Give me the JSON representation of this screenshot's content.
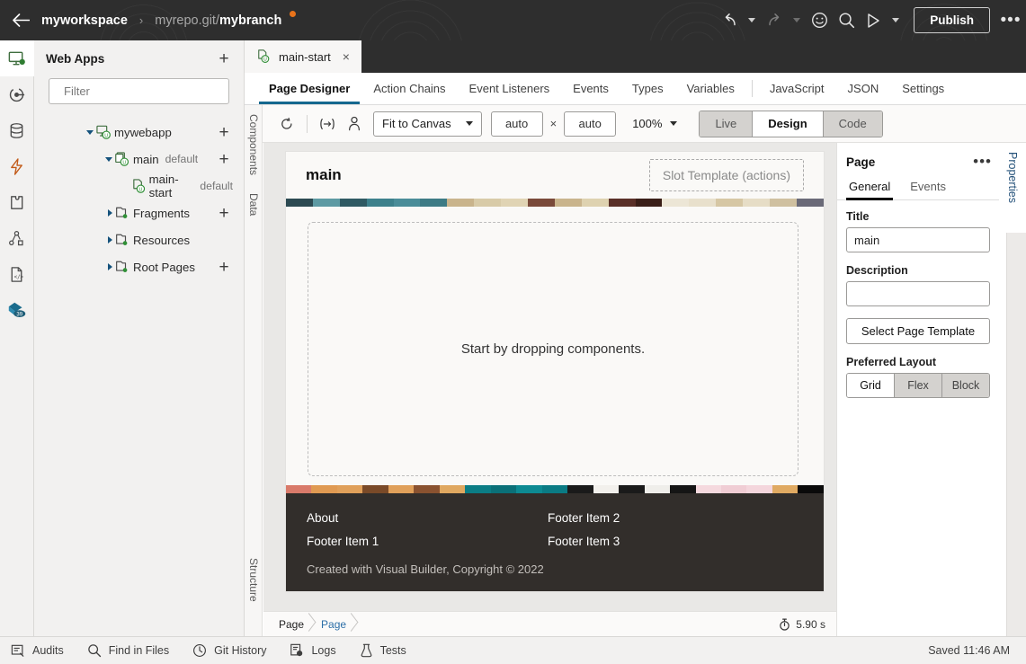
{
  "topbar": {
    "back_icon": "arrow-left-icon",
    "workspace": "myworkspace",
    "separator": "›",
    "repo": "myrepo.git/",
    "branch": "mybranch",
    "actions": [
      {
        "name": "undo-icon",
        "label": "Undo"
      },
      {
        "name": "undo-dropdown",
        "label": "Undo options"
      },
      {
        "name": "redo-icon",
        "label": "Redo"
      },
      {
        "name": "redo-dropdown",
        "label": "Redo options"
      },
      {
        "name": "emoji-icon",
        "label": "Feedback"
      },
      {
        "name": "search-icon",
        "label": "Search"
      },
      {
        "name": "run-icon",
        "label": "Run"
      },
      {
        "name": "run-dropdown",
        "label": "Run options"
      }
    ],
    "publish_label": "Publish",
    "kebab_label": "•••"
  },
  "rail": {
    "items": [
      {
        "name": "web-apps-icon",
        "label": "Web Apps",
        "active": true
      },
      {
        "name": "services-icon",
        "label": "Services",
        "active": false
      },
      {
        "name": "business-objects-icon",
        "label": "Business Objects",
        "active": false
      },
      {
        "name": "processes-icon",
        "label": "Processes",
        "active": false
      },
      {
        "name": "components-icon",
        "label": "Components",
        "active": false
      },
      {
        "name": "mobile-apps-icon",
        "label": "Mobile Apps",
        "active": false
      },
      {
        "name": "source-icon",
        "label": "Source",
        "active": false
      },
      {
        "name": "git-changes-icon",
        "label": "Git Changes",
        "badge": "39",
        "active": false
      }
    ]
  },
  "webapps": {
    "title": "Web Apps",
    "add_label": "+",
    "filter": {
      "placeholder": "Filter",
      "value": ""
    },
    "tree": [
      {
        "name": "mywebapp",
        "label": "mywebapp",
        "sub": "",
        "indent": 0,
        "twisty": "down",
        "icon": "app-icon",
        "add": true
      },
      {
        "name": "main",
        "label": "main",
        "sub": "default",
        "indent": 1,
        "twisty": "down",
        "icon": "flow-icon",
        "add": true
      },
      {
        "name": "main-start",
        "label": "main-start",
        "sub": "default",
        "indent": 2,
        "twisty": "none",
        "icon": "page-icon",
        "add": false
      },
      {
        "name": "fragments",
        "label": "Fragments",
        "sub": "",
        "indent": 1,
        "twisty": "right",
        "icon": "folder-icon",
        "add": true
      },
      {
        "name": "resources",
        "label": "Resources",
        "sub": "",
        "indent": 1,
        "twisty": "right",
        "icon": "folder-icon",
        "add": false
      },
      {
        "name": "root-pages",
        "label": "Root Pages",
        "sub": "",
        "indent": 1,
        "twisty": "right",
        "icon": "folder-icon",
        "add": true
      }
    ]
  },
  "editor": {
    "doc_tab": {
      "label": "main-start",
      "close": "×"
    },
    "subtabs": [
      {
        "label": "Page Designer",
        "active": true,
        "divider_after": false
      },
      {
        "label": "Action Chains",
        "active": false,
        "divider_after": false
      },
      {
        "label": "Event Listeners",
        "active": false,
        "divider_after": false
      },
      {
        "label": "Events",
        "active": false,
        "divider_after": false
      },
      {
        "label": "Types",
        "active": false,
        "divider_after": false
      },
      {
        "label": "Variables",
        "active": false,
        "divider_after": true
      },
      {
        "label": "JavaScript",
        "active": false,
        "divider_after": false
      },
      {
        "label": "JSON",
        "active": false,
        "divider_after": false
      },
      {
        "label": "Settings",
        "active": false,
        "divider_after": false
      }
    ],
    "vtabs": [
      {
        "label": "Components",
        "name": "vtab-components"
      },
      {
        "label": "Data",
        "name": "vtab-data"
      },
      {
        "label": "Structure",
        "name": "vtab-structure"
      }
    ],
    "toolbar": {
      "refresh_icon": "refresh-icon",
      "responsive_icon": "responsive-icon",
      "user_icon": "user-icon",
      "fit_label": "Fit to Canvas",
      "width_value": "auto",
      "height_value": "auto",
      "times": "×",
      "zoom_label": "100%",
      "modes": [
        {
          "label": "Live",
          "active": false
        },
        {
          "label": "Design",
          "active": true
        },
        {
          "label": "Code",
          "active": false
        }
      ]
    },
    "preview": {
      "title": "main",
      "slot_template": "Slot Template (actions)",
      "dropzone_text": "Start by dropping components.",
      "footer": {
        "col1": [
          "About",
          "Footer Item 1"
        ],
        "col2": [
          "Footer Item 2",
          "Footer Item 3"
        ],
        "copyright": "Created with Visual Builder, Copyright © 2022"
      },
      "strip_top_colors": [
        "#2c4a52",
        "#5d9aa3",
        "#2f5a63",
        "#3d818c",
        "#4a8d99",
        "#3d7b85",
        "#c9b48c",
        "#d8cba8",
        "#e0d4b4",
        "#7a4a3a",
        "#c9b48c",
        "#ded2b0",
        "#5a3028",
        "#3a1f18",
        "#ece6d6",
        "#e8e0cc",
        "#d6c7a4",
        "#e6ddc6",
        "#cfc0a0",
        "#6a6a78"
      ],
      "strip_bottom_colors": [
        "#d97a6a",
        "#e09a52",
        "#e0a05a",
        "#7a4a28",
        "#e0a05a",
        "#8a5230",
        "#e0a860",
        "#0b7d85",
        "#0a7078",
        "#0d8a92",
        "#0a7b84",
        "#1a1a1a",
        "#f2f0ec",
        "#1a1a1a",
        "#efeeea",
        "#151515",
        "#f5d9de",
        "#f0cdd4",
        "#f4d6dc",
        "#e0aa62",
        "#0a0a0a"
      ]
    },
    "breadcrumb": [
      {
        "label": "Page",
        "link": false
      },
      {
        "label": "Page",
        "link": true
      }
    ],
    "timer": "5.90 s"
  },
  "properties": {
    "vertical_label": "Properties",
    "header": "Page",
    "kebab": "•••",
    "tabs": [
      {
        "label": "General",
        "active": true
      },
      {
        "label": "Events",
        "active": false
      }
    ],
    "title_label": "Title",
    "title_value": "main",
    "description_label": "Description",
    "description_value": "",
    "select_template_label": "Select Page Template",
    "preferred_layout_label": "Preferred Layout",
    "layout_options": [
      {
        "label": "Grid",
        "active": true
      },
      {
        "label": "Flex",
        "active": false
      },
      {
        "label": "Block",
        "active": false
      }
    ]
  },
  "statusbar": {
    "items": [
      {
        "label": "Audits",
        "icon": "audits-icon"
      },
      {
        "label": "Find in Files",
        "icon": "search-icon"
      },
      {
        "label": "Git History",
        "icon": "clock-icon"
      },
      {
        "label": "Logs",
        "icon": "logs-icon"
      },
      {
        "label": "Tests",
        "icon": "flask-icon"
      }
    ],
    "saved": "Saved 11:46 AM"
  },
  "colors": {
    "topbar_bg": "#2e2e2e",
    "accent_blue": "#15688f",
    "dirty_orange": "#e8731a",
    "footer_bg": "#322e2b",
    "panel_bg": "#f2f1f0"
  }
}
